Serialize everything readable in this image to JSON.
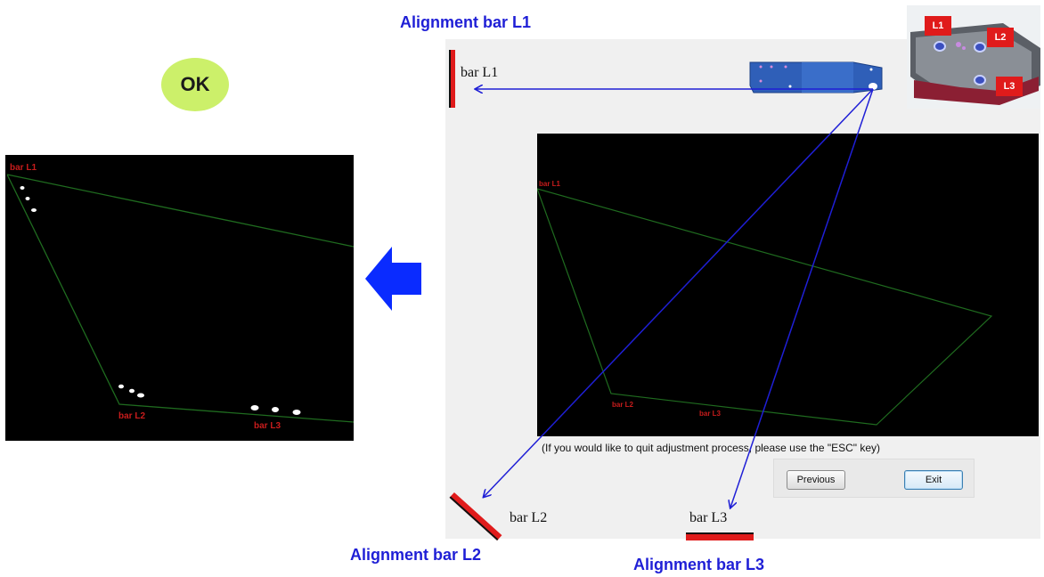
{
  "headings": {
    "l1": "Alignment bar L1",
    "l2": "Alignment bar L2",
    "l3": "Alignment bar L3"
  },
  "status": {
    "result": "OK"
  },
  "result_view": {
    "labels": {
      "l1": "bar L1",
      "l2": "bar L2",
      "l3": "bar L3"
    }
  },
  "app": {
    "bar_labels": {
      "l1": "bar L1",
      "l2": "bar L2",
      "l3": "bar L3"
    },
    "view_labels": {
      "l1": "bar L1",
      "l2": "bar L2",
      "l3": "bar L3"
    },
    "hint": "(If you would like to quit adjustment  process, please use the \"ESC\" key)",
    "buttons": {
      "previous": "Previous",
      "exit": "Exit"
    }
  },
  "photo": {
    "labels": {
      "l1": "L1",
      "l2": "L2",
      "l3": "L3"
    }
  },
  "colors": {
    "heading": "#1f1fd6",
    "ok_badge": "#ccf06a",
    "arrow": "#0a2bff",
    "bar_red": "#e01b1b",
    "label_red": "#c81c1c",
    "outline_green": "#1f6b1f"
  },
  "icons": {
    "direction": "arrow-left-icon"
  }
}
